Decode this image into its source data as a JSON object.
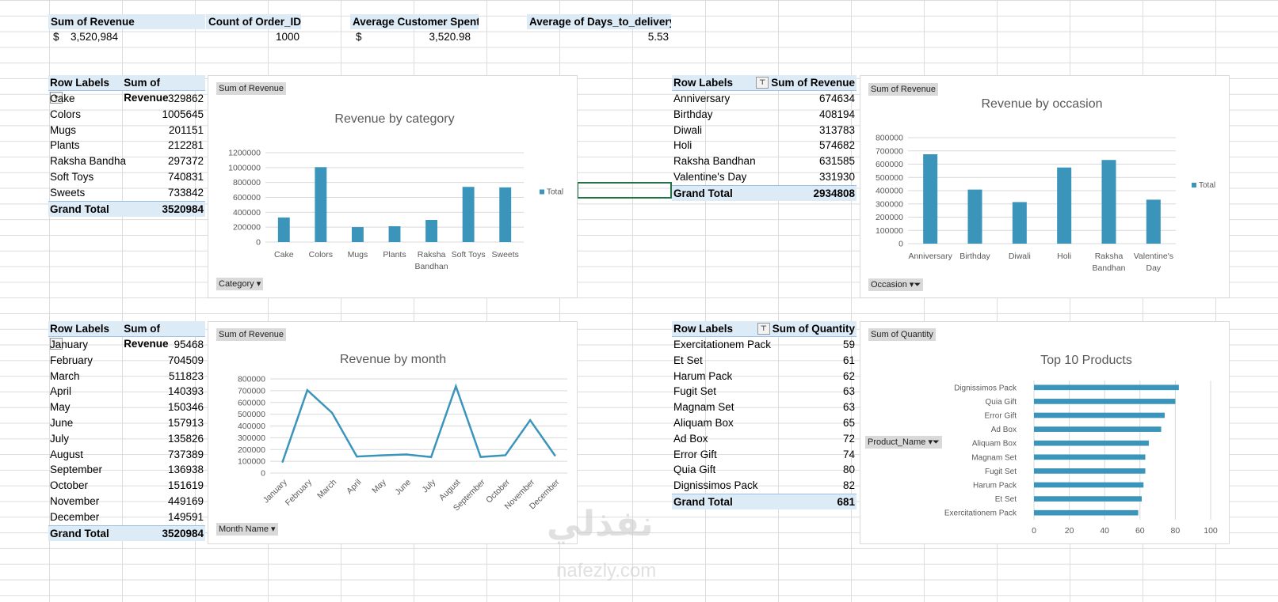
{
  "summary": {
    "revenue_label": "Sum of Revenue",
    "revenue_currency": "$",
    "revenue_value": "3,520,984",
    "orders_label": "Count of Order_ID",
    "orders_value": "1000",
    "avg_spent_label": "Average Customer Spent",
    "avg_spent_currency": "$",
    "avg_spent_value": "3,520.98",
    "avg_days_label": "Average of Days_to_delivery",
    "avg_days_value": "5.53"
  },
  "pivot_category": {
    "row_header": "Row Labels",
    "value_header": "Sum of Revenue",
    "rows": [
      {
        "label": "Cake",
        "value": "329862"
      },
      {
        "label": "Colors",
        "value": "1005645"
      },
      {
        "label": "Mugs",
        "value": "201151"
      },
      {
        "label": "Plants",
        "value": "212281"
      },
      {
        "label": "Raksha Bandha",
        "value": "297372"
      },
      {
        "label": "Soft Toys",
        "value": "740831"
      },
      {
        "label": "Sweets",
        "value": "733842"
      }
    ],
    "total_label": "Grand Total",
    "total_value": "3520984"
  },
  "pivot_occasion": {
    "row_header": "Row Labels",
    "value_header": "Sum of Revenue",
    "rows": [
      {
        "label": "Anniversary",
        "value": "674634"
      },
      {
        "label": "Birthday",
        "value": "408194"
      },
      {
        "label": "Diwali",
        "value": "313783"
      },
      {
        "label": "Holi",
        "value": "574682"
      },
      {
        "label": "Raksha Bandhan",
        "value": "631585"
      },
      {
        "label": "Valentine's Day",
        "value": "331930"
      }
    ],
    "total_label": "Grand Total",
    "total_value": "2934808"
  },
  "pivot_month": {
    "row_header": "Row Labels",
    "value_header": "Sum of Revenue",
    "rows": [
      {
        "label": "January",
        "value": "95468"
      },
      {
        "label": "February",
        "value": "704509"
      },
      {
        "label": "March",
        "value": "511823"
      },
      {
        "label": "April",
        "value": "140393"
      },
      {
        "label": "May",
        "value": "150346"
      },
      {
        "label": "June",
        "value": "157913"
      },
      {
        "label": "July",
        "value": "135826"
      },
      {
        "label": "August",
        "value": "737389"
      },
      {
        "label": "September",
        "value": "136938"
      },
      {
        "label": "October",
        "value": "151619"
      },
      {
        "label": "November",
        "value": "449169"
      },
      {
        "label": "December",
        "value": "149591"
      }
    ],
    "total_label": "Grand Total",
    "total_value": "3520984"
  },
  "pivot_quantity": {
    "row_header": "Row Labels",
    "value_header": "Sum of Quantity",
    "rows": [
      {
        "label": "Exercitationem Pack",
        "value": "59"
      },
      {
        "label": "Et Set",
        "value": "61"
      },
      {
        "label": "Harum Pack",
        "value": "62"
      },
      {
        "label": "Fugit Set",
        "value": "63"
      },
      {
        "label": "Magnam Set",
        "value": "63"
      },
      {
        "label": "Aliquam Box",
        "value": "65"
      },
      {
        "label": "Ad Box",
        "value": "72"
      },
      {
        "label": "Error Gift",
        "value": "74"
      },
      {
        "label": "Quia Gift",
        "value": "80"
      },
      {
        "label": "Dignissimos Pack",
        "value": "82"
      }
    ],
    "total_label": "Grand Total",
    "total_value": "681"
  },
  "chart_tags": {
    "category_value": "Sum of Revenue",
    "category_field": "Category",
    "occasion_value": "Sum of Revenue",
    "occasion_field": "Occasion",
    "month_value": "Sum of Revenue",
    "month_field": "Month Name",
    "top10_value": "Sum of Quantity",
    "top10_field": "Product_Name"
  },
  "watermark": {
    "arabic": "نفذلي",
    "latin": "nafezly.com"
  },
  "colors": {
    "bar": "#3b95bb",
    "header_fill": "#ddebf7",
    "grid": "#dcdcdc"
  },
  "chart_data": [
    {
      "type": "bar",
      "title": "Revenue by category",
      "categories": [
        "Cake",
        "Colors",
        "Mugs",
        "Plants",
        "Raksha Bandhan",
        "Soft Toys",
        "Sweets"
      ],
      "series": [
        {
          "name": "Total",
          "values": [
            329862,
            1005645,
            201151,
            212281,
            297372,
            740831,
            733842
          ]
        }
      ],
      "ylim": [
        0,
        1200000
      ],
      "yticks": [
        0,
        200000,
        400000,
        600000,
        800000,
        1000000,
        1200000
      ],
      "legend": "right",
      "grid": true
    },
    {
      "type": "bar",
      "title": "Revenue by occasion",
      "categories": [
        "Anniversary",
        "Birthday",
        "Diwali",
        "Holi",
        "Raksha Bandhan",
        "Valentine's Day"
      ],
      "series": [
        {
          "name": "Total",
          "values": [
            674634,
            408194,
            313783,
            574682,
            631585,
            331930
          ]
        }
      ],
      "ylim": [
        0,
        800000
      ],
      "yticks": [
        0,
        100000,
        200000,
        300000,
        400000,
        500000,
        600000,
        700000,
        800000
      ],
      "legend": "right",
      "grid": true
    },
    {
      "type": "line",
      "title": "Revenue by month",
      "categories": [
        "January",
        "February",
        "March",
        "April",
        "May",
        "June",
        "July",
        "August",
        "September",
        "October",
        "November",
        "December"
      ],
      "series": [
        {
          "values": [
            95468,
            704509,
            511823,
            140393,
            150346,
            157913,
            135826,
            737389,
            136938,
            151619,
            449169,
            149591
          ]
        }
      ],
      "ylim": [
        0,
        800000
      ],
      "yticks": [
        0,
        100000,
        200000,
        300000,
        400000,
        500000,
        600000,
        700000,
        800000
      ],
      "grid": true
    },
    {
      "type": "bar",
      "orientation": "horizontal",
      "title": "Top 10 Products",
      "categories": [
        "Dignissimos Pack",
        "Quia Gift",
        "Error Gift",
        "Ad Box",
        "Aliquam Box",
        "Magnam Set",
        "Fugit Set",
        "Harum Pack",
        "Et Set",
        "Exercitationem Pack"
      ],
      "series": [
        {
          "values": [
            82,
            80,
            74,
            72,
            65,
            63,
            63,
            62,
            61,
            59
          ]
        }
      ],
      "xlim": [
        0,
        100
      ],
      "xticks": [
        0,
        20,
        40,
        60,
        80,
        100
      ],
      "grid": true
    }
  ]
}
